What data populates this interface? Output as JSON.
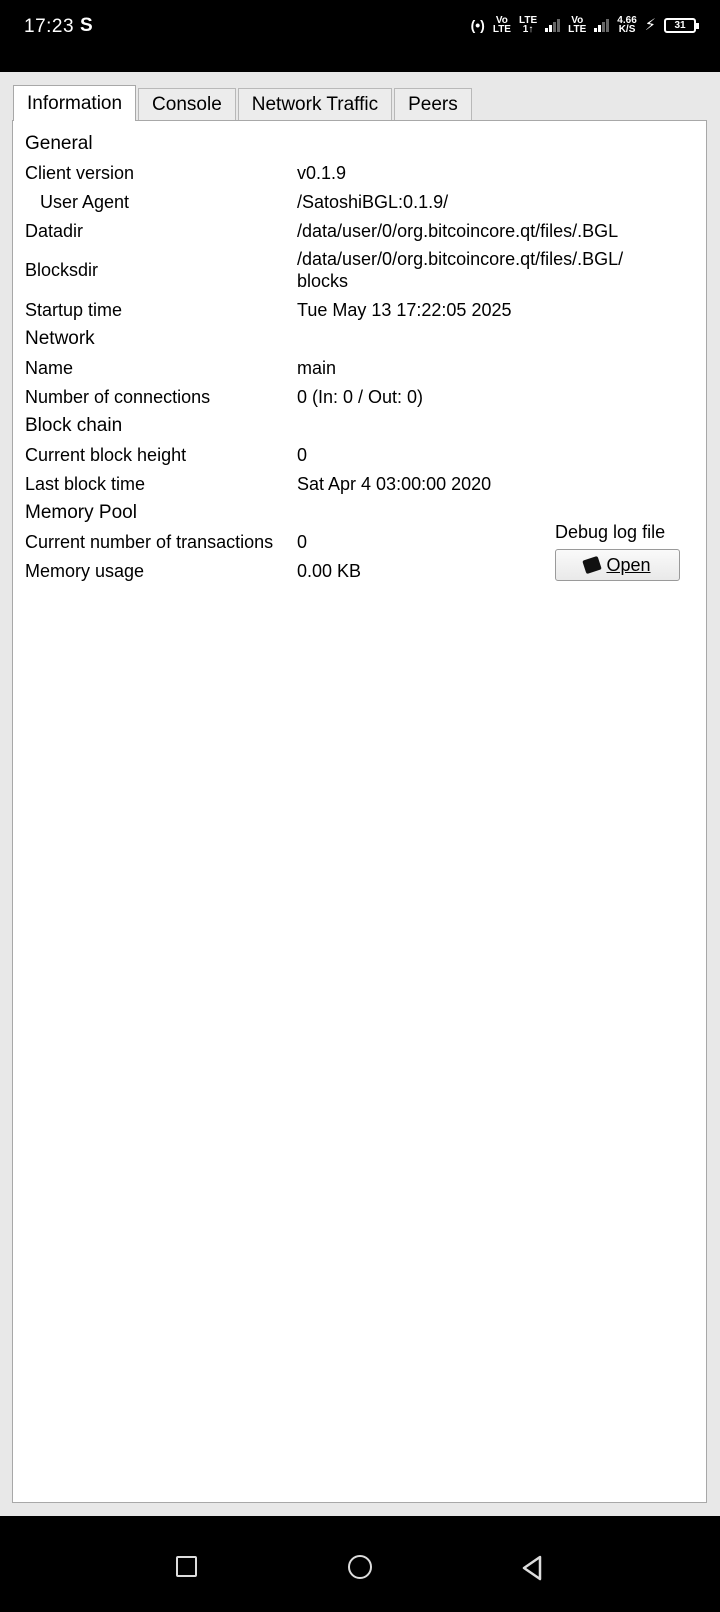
{
  "status_bar": {
    "time": "17:23",
    "s_icon": "S",
    "hotspot_icon": "(•)",
    "sim1_top": "Vo",
    "sim1_bottom": "LTE",
    "lte_top": "LTE",
    "lte_bottom": "1↑",
    "sim2_top": "Vo",
    "sim2_bottom": "LTE",
    "speed_top": "4.66",
    "speed_bottom": "K/S",
    "battery": "31",
    "icons": [
      "hotspot-icon",
      "signal-icon",
      "charging-icon",
      "battery-icon"
    ]
  },
  "tabs": [
    {
      "label": "Information",
      "active": true
    },
    {
      "label": "Console",
      "active": false
    },
    {
      "label": "Network Traffic",
      "active": false
    },
    {
      "label": "Peers",
      "active": false
    }
  ],
  "info": {
    "general": "General",
    "client_version_label": "Client version",
    "client_version": "v0.1.9",
    "user_agent_label": "User Agent",
    "user_agent": "/SatoshiBGL:0.1.9/",
    "datadir_label": "Datadir",
    "datadir": "/data/user/0/org.bitcoincore.qt/files/.BGL",
    "blocksdir_label": "Blocksdir",
    "blocksdir_line1": "/data/user/0/org.bitcoincore.qt/files/.BGL/",
    "blocksdir_line2": "blocks",
    "startup_time_label": "Startup time",
    "startup_time": "Tue May 13 17:22:05 2025",
    "network": "Network",
    "name_label": "Name",
    "name": "main",
    "connections_label": "Number of connections",
    "connections": "0 (In: 0 / Out: 0)",
    "block_chain": "Block chain",
    "block_height_label": "Current block height",
    "block_height": "0",
    "last_block_time_label": "Last block time",
    "last_block_time": "Sat Apr 4 03:00:00 2020",
    "memory_pool": "Memory Pool",
    "transactions_label": "Current number of transactions",
    "transactions": "0",
    "memory_usage_label": "Memory usage",
    "memory_usage": "0.00 KB",
    "debug_log_label": "Debug log file",
    "open_label": "Open"
  }
}
